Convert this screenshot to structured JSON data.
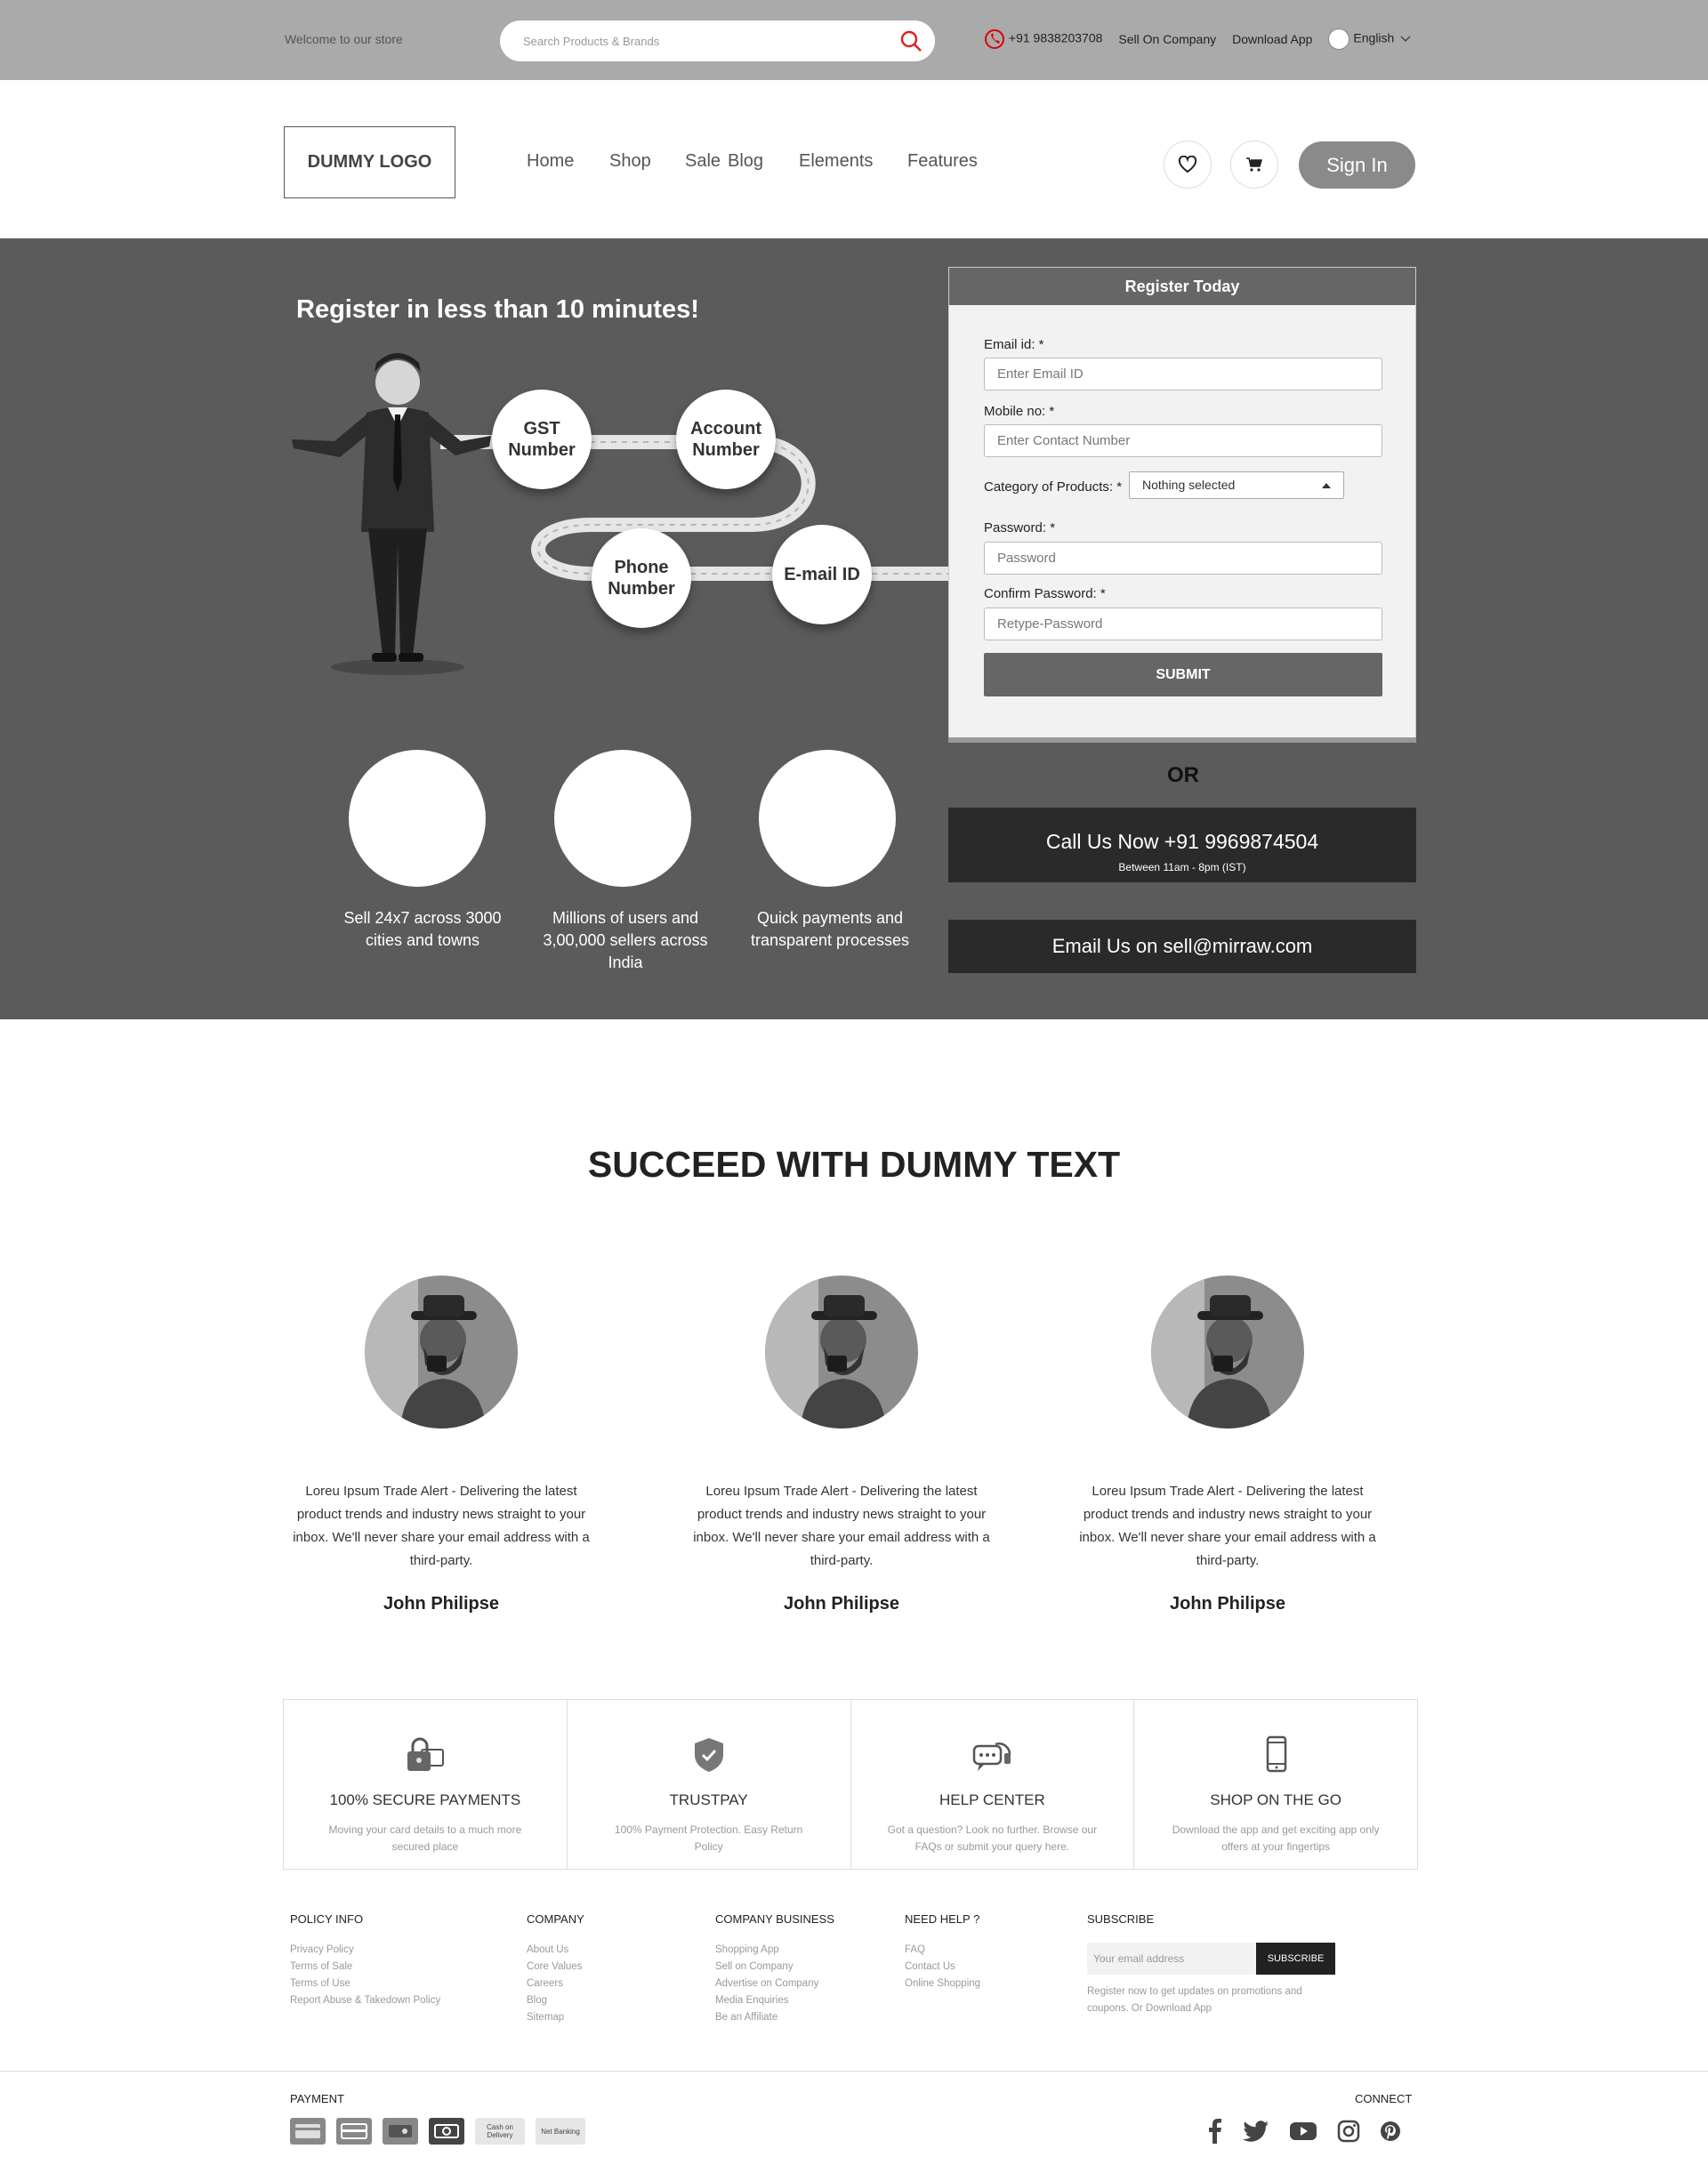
{
  "topbar": {
    "welcome": "Welcome to our store",
    "search_placeholder": "Search Products & Brands",
    "phone": "+91 9838203708",
    "sell": "Sell On Company",
    "download": "Download App",
    "language": "English"
  },
  "nav": {
    "logo": "DUMMY LOGO",
    "links": [
      "Home",
      "Shop",
      "Sale",
      "Blog",
      "Elements",
      "Features"
    ],
    "signin": "Sign In"
  },
  "hero": {
    "title": "Register in less than 10 minutes!",
    "steps": [
      "GST Number",
      "Account Number",
      "Phone Number",
      "E-mail ID"
    ],
    "features": [
      "Sell 24x7 across 3000 cities and towns",
      "Millions of users and 3,00,000 sellers across India",
      "Quick payments and transparent processes"
    ]
  },
  "register": {
    "title": "Register Today",
    "email_label": "Email id: *",
    "email_placeholder": "Enter Email ID",
    "mobile_label": "Mobile no: *",
    "mobile_placeholder": "Enter Contact Number",
    "category_label": "Category of Products: *",
    "category_value": "Nothing selected",
    "password_label": "Password: *",
    "password_placeholder": "Password",
    "confirm_label": "Confirm Password: *",
    "confirm_placeholder": "Retype-Password",
    "submit": "SUBMIT"
  },
  "contact": {
    "or": "OR",
    "call": "Call Us Now +91 9969874504",
    "call_hours": "Between 11am - 8pm (IST)",
    "email": "Email Us on sell@mirraw.com"
  },
  "succeed": {
    "title": "SUCCEED WITH DUMMY TEXT",
    "testimonials": [
      {
        "text": "Loreu Ipsum Trade Alert - Delivering the latest product trends and industry news straight to your inbox. We'll never share your email address with a third-party.",
        "name": "John Philipse"
      },
      {
        "text": "Loreu Ipsum Trade Alert - Delivering the latest product trends and industry news straight to your inbox. We'll never share your email address with a third-party.",
        "name": "John Philipse"
      },
      {
        "text": "Loreu Ipsum Trade Alert - Delivering the latest product trends and industry news straight to your inbox. We'll never share your email address with a third-party.",
        "name": "John Philipse"
      }
    ]
  },
  "features": [
    {
      "title": "100% SECURE PAYMENTS",
      "sub": "Moving your card details to a much more secured place",
      "icon": "lock-card-icon"
    },
    {
      "title": "TRUSTPAY",
      "sub": "100% Payment Protection. Easy Return Policy",
      "icon": "shield-check-icon"
    },
    {
      "title": "HELP CENTER",
      "sub": "Got a question? Look no further. Browse our FAQs or submit your query here.",
      "icon": "chat-headset-icon"
    },
    {
      "title": "SHOP ON THE GO",
      "sub": "Download the app and get exciting app only offers at your fingertips",
      "icon": "mobile-icon"
    }
  ],
  "footer": {
    "policy": {
      "title": "POLICY INFO",
      "items": [
        "Privacy Policy",
        "Terms of Sale",
        "Terms of Use",
        "Report Abuse & Takedown Policy"
      ]
    },
    "company": {
      "title": "COMPANY",
      "items": [
        "About Us",
        "Core Values",
        "Careers",
        "Blog",
        "Sitemap"
      ]
    },
    "business": {
      "title": "COMPANY BUSINESS",
      "items": [
        "Shopping App",
        "Sell on Company",
        "Advertise on Company",
        "Media Enquiries",
        "Be an Affiliate"
      ]
    },
    "help": {
      "title": "NEED HELP ?",
      "items": [
        "FAQ",
        "Contact Us",
        "Online Shopping"
      ]
    },
    "subscribe": {
      "title": "SUBSCRIBE",
      "placeholder": "Your email address",
      "button": "SUBSCRIBE",
      "note": "Register now to get updates on promotions and coupons.",
      "note_link": "Or Download App"
    },
    "payment_label": "PAYMENT",
    "connect_label": "CONNECT",
    "payment_icons": [
      "card-icon",
      "card-icon",
      "wallet-icon",
      "cash-icon",
      "Cash on Delivery",
      "Net Banking"
    ],
    "social_icons": [
      "facebook-icon",
      "twitter-icon",
      "youtube-icon",
      "instagram-icon",
      "pinterest-icon"
    ]
  }
}
